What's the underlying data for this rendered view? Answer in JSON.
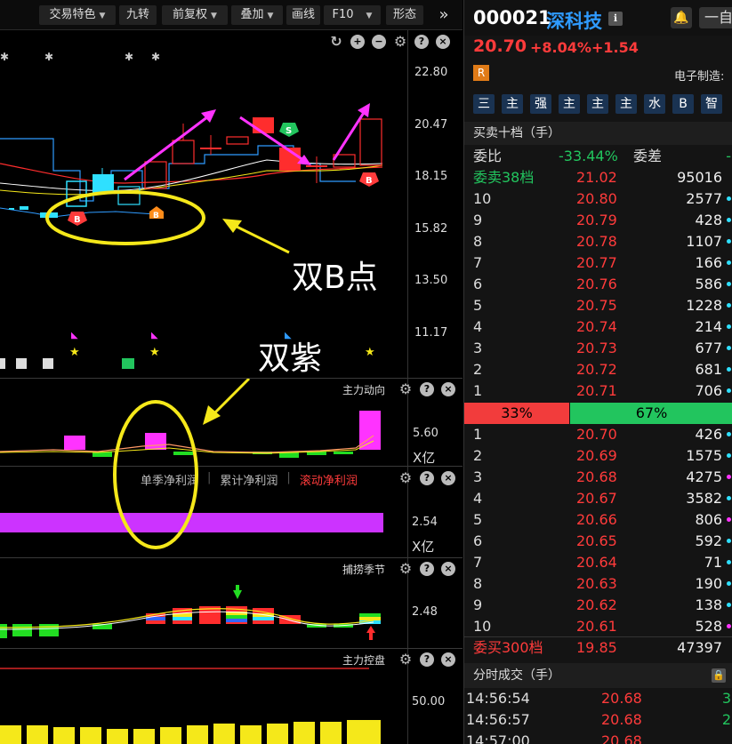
{
  "toolbar": {
    "items": [
      {
        "label": "交易特色",
        "dropdown": true
      },
      {
        "label": "九转",
        "dropdown": false
      },
      {
        "label": "前复权",
        "dropdown": true
      },
      {
        "label": "叠加",
        "dropdown": true
      },
      {
        "label": "画线",
        "dropdown": false
      },
      {
        "label": "F10",
        "dropdown": true
      },
      {
        "label": "形态",
        "dropdown": false
      }
    ],
    "more": "»"
  },
  "main_chart": {
    "price_ticks": [
      "22.80",
      "20.47",
      "18.15",
      "15.82",
      "13.50",
      "11.17"
    ]
  },
  "panes": {
    "zldx": {
      "title": "主力动向",
      "tick": "5.60",
      "unit": "X亿"
    },
    "profit": {
      "tabs": [
        "单季净利润",
        "累计净利润",
        "滚动净利润"
      ],
      "tick": "2.54",
      "unit": "X亿"
    },
    "season": {
      "title": "捕捞季节",
      "tick": "2.48"
    },
    "zlkp": {
      "title": "主力控盘",
      "tick": "50.00"
    }
  },
  "annotations": {
    "double_b": "双B点",
    "double_purple": "双紫"
  },
  "markers": {
    "b": "B",
    "s": "S"
  },
  "quote": {
    "code": "000021",
    "name": "深科技",
    "price": "20.70",
    "change_pct": "+8.04%",
    "change": "+1.54",
    "r_badge": "R",
    "industry": "电子制造:",
    "tags": [
      "三",
      "主",
      "强",
      "主",
      "主",
      "主",
      "水",
      "B",
      "智"
    ],
    "section_title": "买卖十档（手）",
    "weibi_label": "委比",
    "weibi_value": "-33.44%",
    "weicha_label": "委差",
    "weicha_value": "-",
    "sell_total": {
      "label": "委卖38档",
      "price": "21.02",
      "vol": "95016"
    },
    "sells": [
      {
        "lvl": "10",
        "price": "20.80",
        "vol": "2577"
      },
      {
        "lvl": "9",
        "price": "20.79",
        "vol": "428"
      },
      {
        "lvl": "8",
        "price": "20.78",
        "vol": "1107"
      },
      {
        "lvl": "7",
        "price": "20.77",
        "vol": "166"
      },
      {
        "lvl": "6",
        "price": "20.76",
        "vol": "586"
      },
      {
        "lvl": "5",
        "price": "20.75",
        "vol": "1228"
      },
      {
        "lvl": "4",
        "price": "20.74",
        "vol": "214"
      },
      {
        "lvl": "3",
        "price": "20.73",
        "vol": "677"
      },
      {
        "lvl": "2",
        "price": "20.72",
        "vol": "681"
      },
      {
        "lvl": "1",
        "price": "20.71",
        "vol": "706"
      }
    ],
    "ratio": {
      "sell": "33%",
      "buy": "67%"
    },
    "buys": [
      {
        "lvl": "1",
        "price": "20.70",
        "vol": "426"
      },
      {
        "lvl": "2",
        "price": "20.69",
        "vol": "1575"
      },
      {
        "lvl": "3",
        "price": "20.68",
        "vol": "4275"
      },
      {
        "lvl": "4",
        "price": "20.67",
        "vol": "3582"
      },
      {
        "lvl": "5",
        "price": "20.66",
        "vol": "806"
      },
      {
        "lvl": "6",
        "price": "20.65",
        "vol": "592"
      },
      {
        "lvl": "7",
        "price": "20.64",
        "vol": "71"
      },
      {
        "lvl": "8",
        "price": "20.63",
        "vol": "190"
      },
      {
        "lvl": "9",
        "price": "20.62",
        "vol": "138"
      },
      {
        "lvl": "10",
        "price": "20.61",
        "vol": "528"
      }
    ],
    "buy_total": {
      "label": "委买300档",
      "price": "19.85",
      "vol": "47397"
    },
    "ticks_title": "分时成交（手）",
    "ticks": [
      {
        "time": "14:56:54",
        "price": "20.68",
        "vol": "3"
      },
      {
        "time": "14:56:57",
        "price": "20.68",
        "vol": "2"
      },
      {
        "time": "14:57:00",
        "price": "20.68",
        "vol": ""
      }
    ],
    "ticks_extra": [
      "自"
    ]
  },
  "colors": {
    "up": "#ff3b3b",
    "down": "#22c55e",
    "accent_blue": "#2f9bff",
    "annotation_yellow": "#f5e81a",
    "magenta": "#ff33ff"
  }
}
